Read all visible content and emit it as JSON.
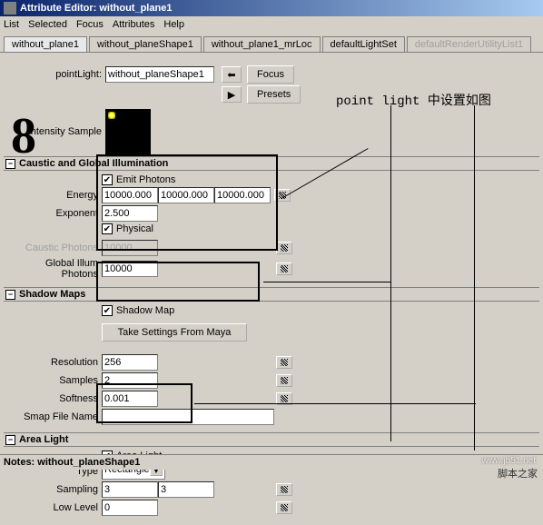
{
  "window": {
    "title": "Attribute Editor: without_plane1"
  },
  "menu": {
    "list": "List",
    "selected": "Selected",
    "focus": "Focus",
    "attributes": "Attributes",
    "help": "Help"
  },
  "tabs": [
    "without_plane1",
    "without_planeShape1",
    "without_plane1_mrLoc",
    "defaultLightSet",
    "defaultRenderUtilityList1"
  ],
  "header": {
    "typeLabel": "pointLight:",
    "typeValue": "without_planeShape1",
    "focusBtn": "Focus",
    "presetsBtn": "Presets",
    "intensityLabel": "Intensity Sample"
  },
  "caustic": {
    "title": "Caustic and Global Illumination",
    "emitPhotons": "Emit Photons",
    "energyLabel": "Energy",
    "e0": "10000.000",
    "e1": "10000.000",
    "e2": "10000.000",
    "exponentLabel": "Exponent",
    "exponent": "2.500",
    "physical": "Physical",
    "causticLabel": "Caustic Photons",
    "causticVal": "10000",
    "globalLabel": "Global Illum Photons",
    "globalVal": "10000"
  },
  "shadow": {
    "title": "Shadow Maps",
    "shadowMap": "Shadow Map",
    "takeBtn": "Take Settings From Maya",
    "resLabel": "Resolution",
    "res": "256",
    "samplesLabel": "Samples",
    "samples": "2",
    "softLabel": "Softness",
    "soft": "0.001",
    "fileLabel": "Smap File Name",
    "file": ""
  },
  "area": {
    "title": "Area Light",
    "areaLight": "Area Light",
    "typeLabel": "Type",
    "typeVal": "Rectangle",
    "samplingLabel": "Sampling",
    "s0": "3",
    "s1": "3",
    "lowLabel": "Low Level",
    "low": "0"
  },
  "notes": {
    "label": "Notes: without_planeShape1"
  },
  "annotation": "point light 中设置如图",
  "watermark": "www.jb51.net",
  "site": "脚本之家"
}
